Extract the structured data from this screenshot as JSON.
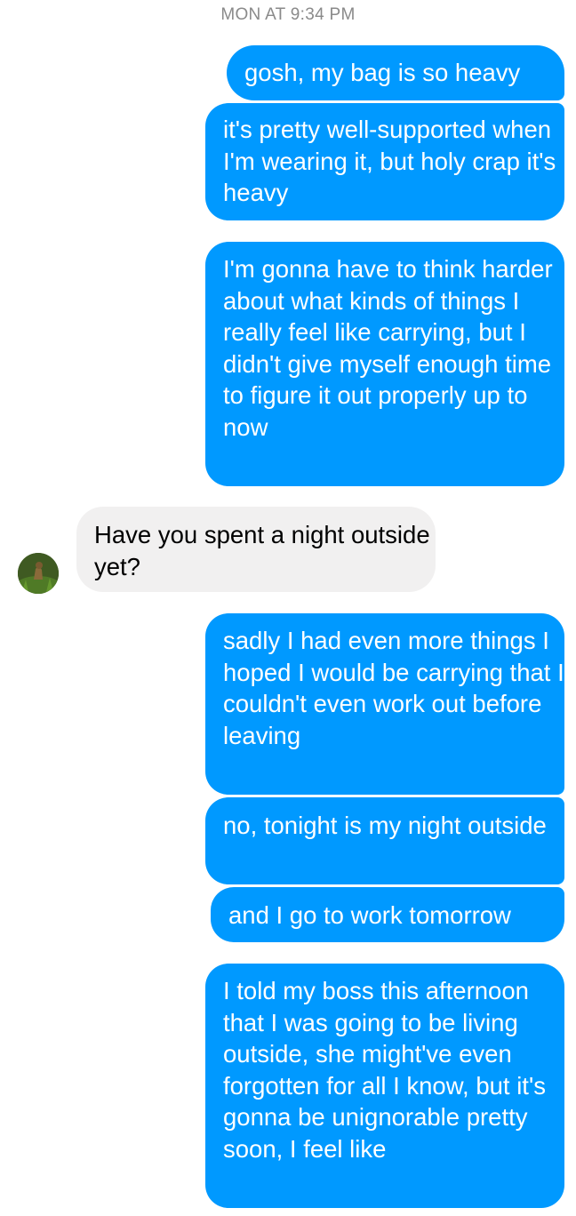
{
  "timestamp": "MON AT 9:34 PM",
  "messages": [
    {
      "id": "b1",
      "sender": "me",
      "text": "gosh, my bag is so heavy"
    },
    {
      "id": "b2",
      "sender": "me",
      "text": "it's pretty well-supported when I'm wearing it, but holy crap it's heavy"
    },
    {
      "id": "b3",
      "sender": "me",
      "text": "I'm gonna have to think harder about what kinds of things I really feel like carrying, but I didn't give myself enough time to figure it out properly up to now"
    },
    {
      "id": "b4",
      "sender": "other",
      "text": "Have you spent a night outside yet?"
    },
    {
      "id": "b5",
      "sender": "me",
      "text": "sadly I had even more things I hoped I would be carrying that I couldn't even work out before leaving"
    },
    {
      "id": "b6",
      "sender": "me",
      "text": "no, tonight is my night outside"
    },
    {
      "id": "b7",
      "sender": "me",
      "text": "and I go to work tomorrow"
    },
    {
      "id": "b8",
      "sender": "me",
      "text": "I told my boss this afternoon that I was going to be living outside, she might've even forgotten for all I know, but it's gonna be unignorable pretty soon, I feel like"
    }
  ],
  "colors": {
    "outgoing_bubble": "#0099ff",
    "incoming_bubble": "#f1f0f0",
    "timestamp_text": "#8a8a8a"
  },
  "avatar": {
    "icon": "contact-avatar"
  }
}
